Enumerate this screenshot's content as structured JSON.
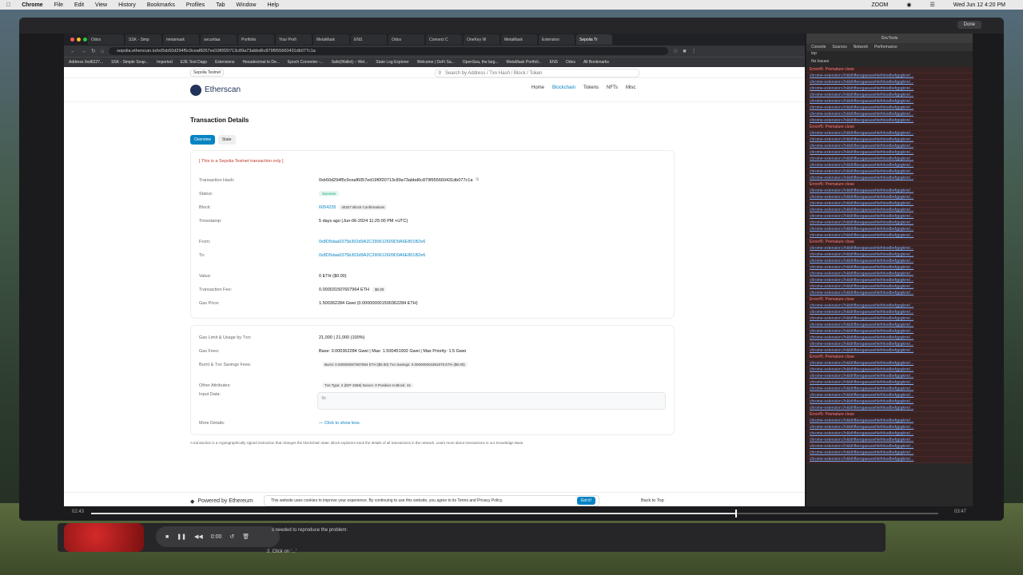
{
  "menubar": {
    "app": "Chrome",
    "items": [
      "File",
      "Edit",
      "View",
      "History",
      "Bookmarks",
      "Profiles",
      "Tab",
      "Window",
      "Help"
    ],
    "clock": "Wed Jun 12  4:20 PM",
    "zoom": "ZOOM"
  },
  "recorder": {
    "done": "Done",
    "devtools_title": "DevTools",
    "time_elapsed": "02:43",
    "time_total": "03:47",
    "progress": 0.76,
    "audio_time": "0:00",
    "issue_line1": "s needed to reproduce the problem:",
    "issue_line2": "2. Click on '...'"
  },
  "browser": {
    "tabs": [
      "Odos",
      "SSK - Simp",
      "metamask",
      "securitaa",
      "Portfolio",
      "Your Profi",
      "MetaMask",
      "ENS",
      "Odos",
      "Connect C",
      "OneKey W",
      "MetaMask",
      "Extension",
      "Sepolia Tr"
    ],
    "url": "sepolia.etherscan.io/tx/0xb50d294f5c9ceaf6057ed19f0f20713c89a73abbd6c879f955660431db077c1a",
    "bookmarks": [
      "Address 0xd6227...",
      "SSK - Simple Snap...",
      "Imported",
      "E2E Test Dapp",
      "Extensions",
      "Hexadecimal to De...",
      "Epoch Converter -...",
      "Safe{Wallet} – Wel...",
      "State Log Explorer",
      "Welcome | DeFi Sa...",
      "OpenSea, the larg...",
      "MetaMask Portfoli...",
      "ENS",
      "Odos",
      "All Bookmarks"
    ]
  },
  "site": {
    "network_badge": "Sepolia Testnet",
    "search_placeholder": "Search by Address / Txn Hash / Block / Token",
    "logo": "Etherscan",
    "nav": [
      "Home",
      "Blockchain",
      "Tokens",
      "NFTs",
      "Misc"
    ],
    "page_title": "Transaction Details",
    "tabs": [
      "Overview",
      "State"
    ],
    "notice": "[ This is a Sepolia Testnet transaction only ]",
    "rows": [
      {
        "label": "Transaction Hash:",
        "value": "0xb50d294f5c9ceaf6057ed19f0f20713c89a73abbd6c879f955660431db077c1a"
      },
      {
        "label": "Status:",
        "value": "Success"
      },
      {
        "label": "Block:",
        "value": "6054235",
        "extra": "40327 Block Confirmations"
      },
      {
        "label": "Timestamp:",
        "value": "5 days ago (Jun-06-2024 11:25:00 PM +UTC)"
      },
      {
        "label": "From:",
        "value": "0x8D5daa0375b302d9A2C290612609D9A6E801B2e6"
      },
      {
        "label": "To:",
        "value": "0x8D5daa0375b302d9A2C290612609D9A6E801B2e6"
      },
      {
        "label": "Value:",
        "value": "0 ETH ($0.00)"
      },
      {
        "label": "Transaction Fee:",
        "value": "0.000031507607964 ETH",
        "extra": "$0.00"
      },
      {
        "label": "Gas Price:",
        "value": "1.500362284 Gwei (0.000000001500362284 ETH)"
      }
    ],
    "rows2": [
      {
        "label": "Gas Limit & Usage by Txn:",
        "value": "21,000   |   21,000 (100%)"
      },
      {
        "label": "Gas Fees:",
        "value": "Base: 0.000362284 Gwei  |  Max: 1.500451902 Gwei  |  Max Priority: 1.5 Gwei"
      },
      {
        "label": "Burnt & Txn Savings Fees:",
        "value": "Burnt: 0.000000007607964 ETH ($0.00)    Txn Savings: 0.000000001881978 ETH ($0.00)"
      },
      {
        "label": "Other Attributes:",
        "value": "Txn Type: 2 (EIP-1559)    Nonce: 0    Position In Block: 44"
      },
      {
        "label": "Input Data:",
        "value": "0x"
      }
    ],
    "more_label": "More Details:",
    "more_link": "— Click to show less",
    "footnote": "A transaction is a cryptographically signed instruction that changes the blockchain state. Block explorers track the details of all transactions in the network. Learn more about transactions in our Knowledge Base.",
    "powered": "Powered by Ethereum",
    "cookie": "This website uses cookies to improve your experience. By continuing to use this website, you agree to its Terms and Privacy Policy.",
    "got_it": "Got it!",
    "back_top": "Back to Top"
  },
  "devtools": {
    "tabs": [
      "Console",
      "Sources",
      "Network",
      "Performance"
    ],
    "filter": "top",
    "status": "No Issues",
    "error_line": "Error#5: Premature close",
    "link": "chrome-extension://nkbihfbeogaeaoehlefnkodbefgpgknn/..."
  }
}
